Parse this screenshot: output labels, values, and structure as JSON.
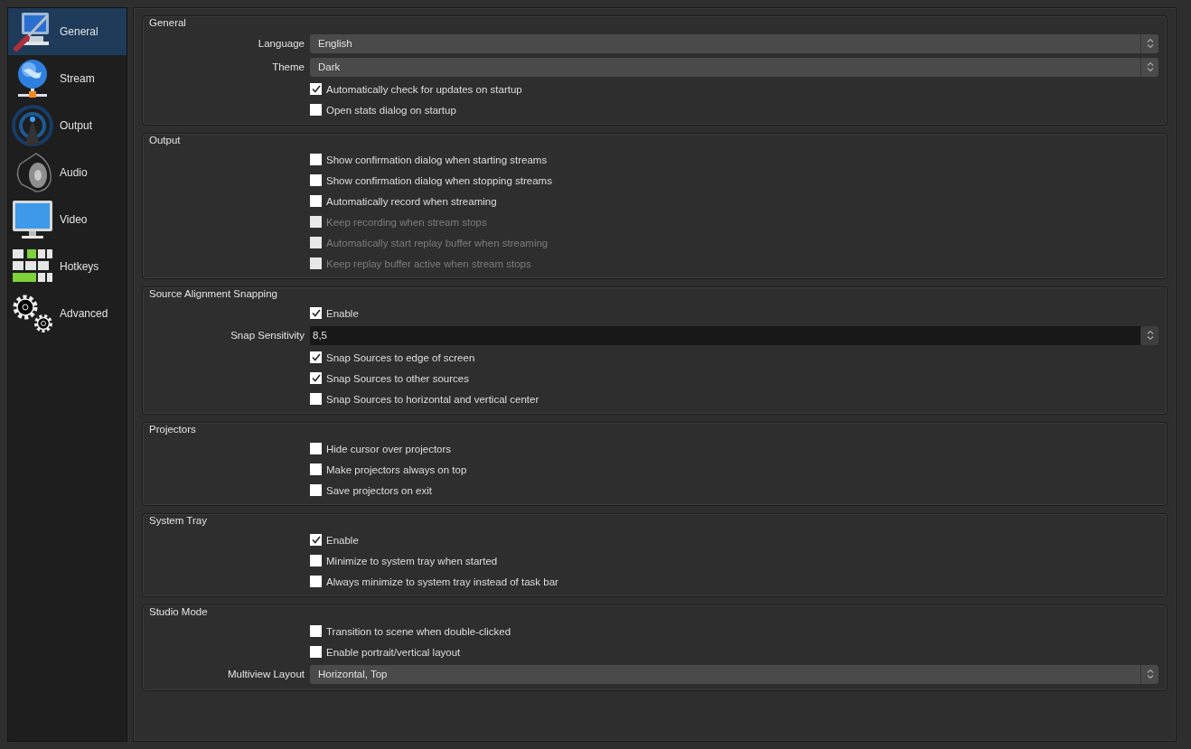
{
  "sidebar": {
    "items": [
      {
        "label": "General",
        "selected": true
      },
      {
        "label": "Stream",
        "selected": false
      },
      {
        "label": "Output",
        "selected": false
      },
      {
        "label": "Audio",
        "selected": false
      },
      {
        "label": "Video",
        "selected": false
      },
      {
        "label": "Hotkeys",
        "selected": false
      },
      {
        "label": "Advanced",
        "selected": false
      }
    ]
  },
  "groups": [
    {
      "title": "General",
      "rows": [
        {
          "kind": "combo",
          "label": "Language",
          "value": "English"
        },
        {
          "kind": "combo",
          "label": "Theme",
          "value": "Dark"
        },
        {
          "kind": "checkbox",
          "label": "Automatically check for updates on startup",
          "checked": true,
          "disabled": false
        },
        {
          "kind": "checkbox",
          "label": "Open stats dialog on startup",
          "checked": false,
          "disabled": false
        }
      ]
    },
    {
      "title": "Output",
      "rows": [
        {
          "kind": "checkbox",
          "label": "Show confirmation dialog when starting streams",
          "checked": false,
          "disabled": false
        },
        {
          "kind": "checkbox",
          "label": "Show confirmation dialog when stopping streams",
          "checked": false,
          "disabled": false
        },
        {
          "kind": "checkbox",
          "label": "Automatically record when streaming",
          "checked": false,
          "disabled": false
        },
        {
          "kind": "checkbox",
          "label": "Keep recording when stream stops",
          "checked": false,
          "disabled": true
        },
        {
          "kind": "checkbox",
          "label": "Automatically start replay buffer when streaming",
          "checked": false,
          "disabled": true
        },
        {
          "kind": "checkbox",
          "label": "Keep replay buffer active when stream stops",
          "checked": false,
          "disabled": true
        }
      ]
    },
    {
      "title": "Source Alignment Snapping",
      "rows": [
        {
          "kind": "checkbox",
          "label": "Enable",
          "checked": true,
          "disabled": false
        },
        {
          "kind": "spin",
          "label": "Snap Sensitivity",
          "value": "8,5"
        },
        {
          "kind": "checkbox",
          "label": "Snap Sources to edge of screen",
          "checked": true,
          "disabled": false
        },
        {
          "kind": "checkbox",
          "label": "Snap Sources to other sources",
          "checked": true,
          "disabled": false
        },
        {
          "kind": "checkbox",
          "label": "Snap Sources to horizontal and vertical center",
          "checked": false,
          "disabled": false
        }
      ]
    },
    {
      "title": "Projectors",
      "rows": [
        {
          "kind": "checkbox",
          "label": "Hide cursor over projectors",
          "checked": false,
          "disabled": false
        },
        {
          "kind": "checkbox",
          "label": "Make projectors always on top",
          "checked": false,
          "disabled": false
        },
        {
          "kind": "checkbox",
          "label": "Save projectors on exit",
          "checked": false,
          "disabled": false
        }
      ]
    },
    {
      "title": "System Tray",
      "rows": [
        {
          "kind": "checkbox",
          "label": "Enable",
          "checked": true,
          "disabled": false
        },
        {
          "kind": "checkbox",
          "label": "Minimize to system tray when started",
          "checked": false,
          "disabled": false
        },
        {
          "kind": "checkbox",
          "label": "Always minimize to system tray instead of task bar",
          "checked": false,
          "disabled": false
        }
      ]
    },
    {
      "title": "Studio Mode",
      "rows": [
        {
          "kind": "checkbox",
          "label": "Transition to scene when double-clicked",
          "checked": false,
          "disabled": false
        },
        {
          "kind": "checkbox",
          "label": "Enable portrait/vertical layout",
          "checked": false,
          "disabled": false
        },
        {
          "kind": "combo",
          "label": "Multiview Layout",
          "value": "Horizontal, Top"
        }
      ]
    }
  ]
}
